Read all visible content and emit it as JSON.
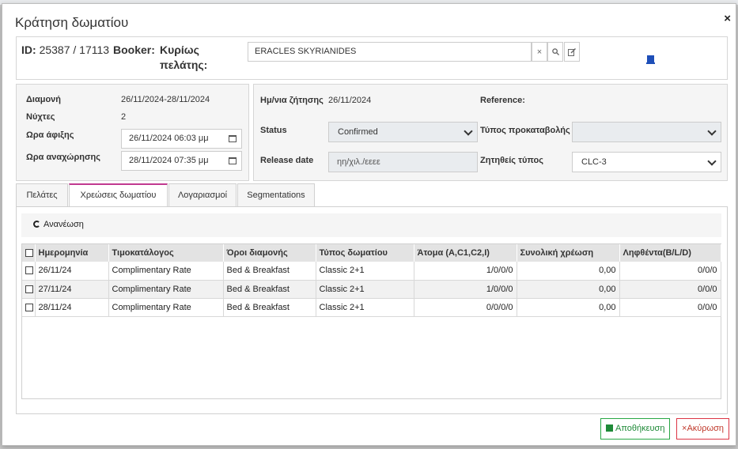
{
  "dialog": {
    "title": "Κράτηση δωματίου",
    "close_glyph": "×"
  },
  "header": {
    "id_label": "ID:",
    "id_value": "25387 / 17113",
    "booker_label": "Booker:",
    "client_label": "Κυρίως πελάτης:",
    "client_value": "ERACLES SKYRIANIDES",
    "clear_glyph": "×"
  },
  "stay": {
    "stay_label": "Διαμονή",
    "stay_value": "26/11/2024-28/11/2024",
    "nights_label": "Νύχτες",
    "nights_value": "2",
    "arrival_label": "Ωρα άφιξης",
    "arrival_value": "26/11/2024 06:03 μμ",
    "departure_label": "Ωρα αναχώρησης",
    "departure_value": "28/11/2024 07:35 μμ"
  },
  "request": {
    "request_date_label": "Ημ/νια ζήτησης",
    "request_date_value": "26/11/2024",
    "reference_label": "Reference:",
    "status_label": "Status",
    "status_value": "Confirmed",
    "deposit_type_label": "Τύπος προκαταβολής",
    "deposit_type_value": "",
    "release_date_label": "Release date",
    "release_date_placeholder": "ηη/χιλ./εεεε",
    "requested_type_label": "Ζητηθείς τύπος",
    "requested_type_value": "CLC-3"
  },
  "tabs": [
    {
      "label": "Πελάτες"
    },
    {
      "label": "Χρεώσεις δωματίου"
    },
    {
      "label": "Λογαριασμοί"
    },
    {
      "label": "Segmentations"
    }
  ],
  "charges": {
    "refresh_label": "Ανανέωση",
    "columns": [
      "Ημερομηνία",
      "Τιμοκατάλογος",
      "Όροι διαμονής",
      "Τύπος δωματίου",
      "Άτομα (A,C1,C2,I)",
      "Συνολική χρέωση",
      "Ληφθέντα(B/L/D)"
    ],
    "rows": [
      {
        "date": "26/11/24",
        "rate": "Complimentary Rate",
        "board": "Bed & Breakfast",
        "room_type": "Classic 2+1",
        "persons": "1/0/0/0",
        "total": "0,00",
        "received": "0/0/0"
      },
      {
        "date": "27/11/24",
        "rate": "Complimentary Rate",
        "board": "Bed & Breakfast",
        "room_type": "Classic 2+1",
        "persons": "1/0/0/0",
        "total": "0,00",
        "received": "0/0/0"
      },
      {
        "date": "28/11/24",
        "rate": "Complimentary Rate",
        "board": "Bed & Breakfast",
        "room_type": "Classic 2+1",
        "persons": "0/0/0/0",
        "total": "0,00",
        "received": "0/0/0"
      }
    ]
  },
  "footer": {
    "save_label": "Αποθήκευση",
    "cancel_label": "Ακύρωση",
    "cancel_glyph": "×"
  },
  "colors": {
    "active_tab_accent": "#c0398f",
    "save": "#28a745",
    "cancel": "#dc3545",
    "marker": "#1e4fb8"
  }
}
